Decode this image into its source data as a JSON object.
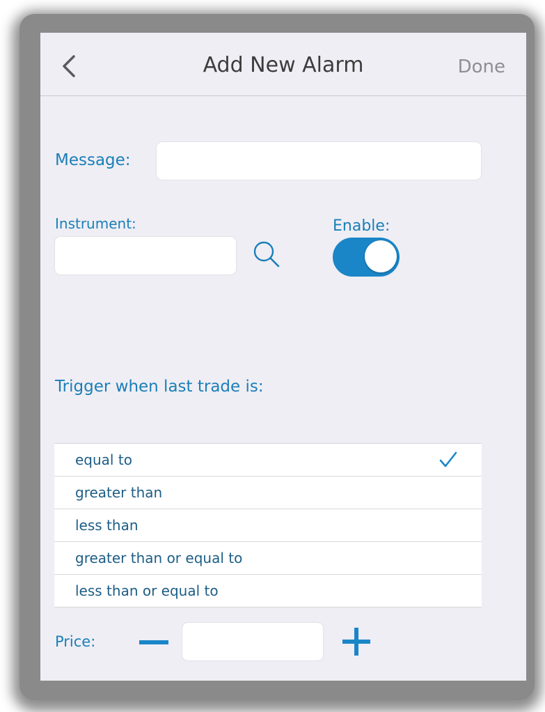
{
  "navbar": {
    "title": "Add New Alarm",
    "done_label": "Done"
  },
  "message": {
    "label": "Message:",
    "value": ""
  },
  "instrument": {
    "label": "Instrument:",
    "value": ""
  },
  "enable": {
    "label": "Enable:",
    "on": true
  },
  "trigger": {
    "label": "Trigger when last trade is:",
    "options": [
      {
        "label": "equal to",
        "selected": true
      },
      {
        "label": "greater than",
        "selected": false
      },
      {
        "label": "less than",
        "selected": false
      },
      {
        "label": "greater than or equal to",
        "selected": false
      },
      {
        "label": "less than or equal to",
        "selected": false
      }
    ]
  },
  "price": {
    "label": "Price:",
    "value": ""
  },
  "icons": {
    "back": "chevron-left-icon",
    "search": "search-icon",
    "check": "checkmark-icon",
    "minus": "minus-icon",
    "plus": "plus-icon"
  },
  "colors": {
    "accent": "#1a86c8",
    "label": "#1a7fb8",
    "background": "#efeef4"
  }
}
